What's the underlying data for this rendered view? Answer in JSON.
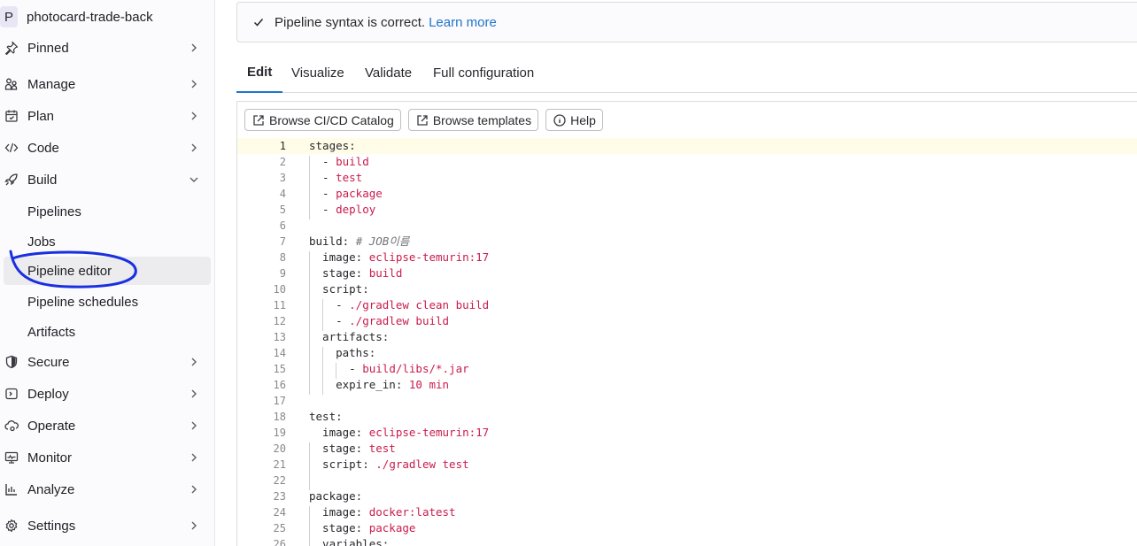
{
  "sidebar": {
    "project": {
      "avatar": "P",
      "name": "photocard-trade-back"
    },
    "items": [
      {
        "label": "Pinned",
        "icon": "pin-icon"
      },
      {
        "label": "Manage",
        "icon": "users-icon"
      },
      {
        "label": "Plan",
        "icon": "calendar-icon"
      },
      {
        "label": "Code",
        "icon": "code-icon"
      },
      {
        "label": "Build",
        "icon": "rocket-icon"
      },
      {
        "label": "Secure",
        "icon": "shield-icon"
      },
      {
        "label": "Deploy",
        "icon": "deployments-icon"
      },
      {
        "label": "Operate",
        "icon": "cloud-gear-icon"
      },
      {
        "label": "Monitor",
        "icon": "monitor-icon"
      },
      {
        "label": "Analyze",
        "icon": "chart-icon"
      },
      {
        "label": "Settings",
        "icon": "gear-icon"
      }
    ],
    "build_subitems": [
      "Pipelines",
      "Jobs",
      "Pipeline editor",
      "Pipeline schedules",
      "Artifacts"
    ],
    "active_subitem": "Pipeline editor",
    "annotation_color": "#1a2fe0"
  },
  "alert": {
    "text": "Pipeline syntax is correct.",
    "link": "Learn more"
  },
  "tabs": [
    "Edit",
    "Visualize",
    "Validate",
    "Full configuration"
  ],
  "active_tab": "Edit",
  "toolbar": {
    "catalog": "Browse CI/CD Catalog",
    "templates": "Browse templates",
    "help": "Help"
  },
  "editor": {
    "current_line": 1,
    "lines": [
      [
        [
          "k",
          "stages:"
        ]
      ],
      [
        [
          "k",
          "  - "
        ],
        [
          "v",
          "build"
        ]
      ],
      [
        [
          "k",
          "  - "
        ],
        [
          "v",
          "test"
        ]
      ],
      [
        [
          "k",
          "  - "
        ],
        [
          "v",
          "package"
        ]
      ],
      [
        [
          "k",
          "  - "
        ],
        [
          "v",
          "deploy"
        ]
      ],
      [],
      [
        [
          "k",
          "build: "
        ],
        [
          "c",
          "# JOB이름"
        ]
      ],
      [
        [
          "k",
          "  image: "
        ],
        [
          "v",
          "eclipse-temurin:17"
        ]
      ],
      [
        [
          "k",
          "  stage: "
        ],
        [
          "v",
          "build"
        ]
      ],
      [
        [
          "k",
          "  script:"
        ]
      ],
      [
        [
          "k",
          "    - "
        ],
        [
          "v",
          "./gradlew clean build"
        ]
      ],
      [
        [
          "k",
          "    - "
        ],
        [
          "v",
          "./gradlew build"
        ]
      ],
      [
        [
          "k",
          "  artifacts:"
        ]
      ],
      [
        [
          "k",
          "    paths:"
        ]
      ],
      [
        [
          "k",
          "      - "
        ],
        [
          "v",
          "build/libs/*.jar"
        ]
      ],
      [
        [
          "k",
          "    expire_in: "
        ],
        [
          "v",
          "10 min"
        ]
      ],
      [],
      [
        [
          "k",
          "test:"
        ]
      ],
      [
        [
          "k",
          "  image: "
        ],
        [
          "v",
          "eclipse-temurin:17"
        ]
      ],
      [
        [
          "k",
          "  stage: "
        ],
        [
          "v",
          "test"
        ]
      ],
      [
        [
          "k",
          "  script: "
        ],
        [
          "v",
          "./gradlew test"
        ]
      ],
      [],
      [
        [
          "k",
          "package:"
        ]
      ],
      [
        [
          "k",
          "  image: "
        ],
        [
          "v",
          "docker:latest"
        ]
      ],
      [
        [
          "k",
          "  stage: "
        ],
        [
          "v",
          "package"
        ]
      ],
      [
        [
          "k",
          "  variables:"
        ]
      ]
    ]
  },
  "colors": {
    "accent": "#1f75cb",
    "yaml_value": "#c91c4c"
  }
}
